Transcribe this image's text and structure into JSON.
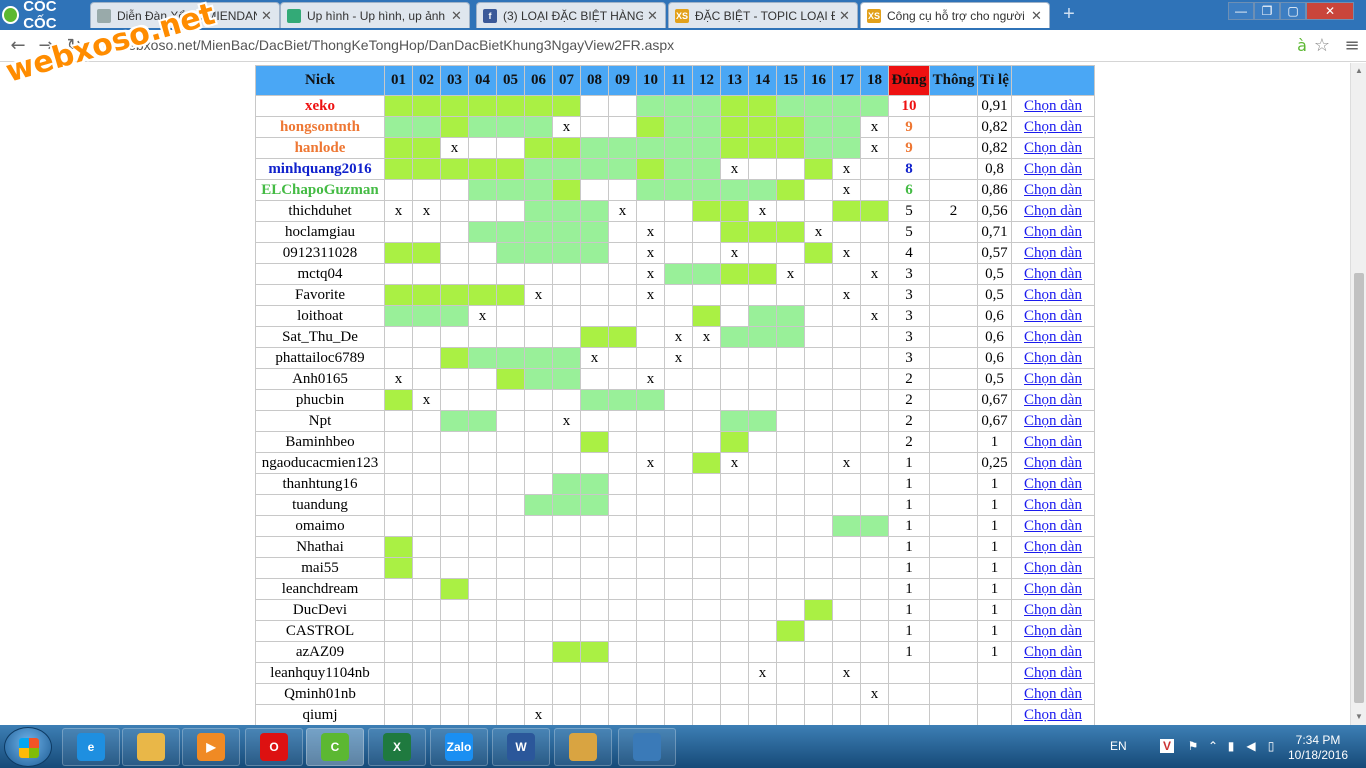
{
  "browser": {
    "logo_text": "CỐC CỐC",
    "tabs": [
      {
        "title": "Diễn Đàn Xổ Số MIENDAN",
        "icon": "doc-icon",
        "active": false
      },
      {
        "title": "Up hình - Up hình, up ảnh",
        "icon": "image-icon",
        "active": false
      },
      {
        "title": "(3) LOẠI ĐẶC BIỆT HÀNG N",
        "icon": "facebook-icon",
        "active": false
      },
      {
        "title": "ĐẶC BIỆT - TOPIC LOẠI ĐẶ",
        "icon": "xs-icon",
        "active": false
      },
      {
        "title": "Công cụ hỗ trợ cho người",
        "icon": "xs-icon",
        "active": true
      }
    ],
    "url_prefix": "",
    "url": "webxoso.net/MienBac/DacBiet/ThongKeTongHop/DanDacBietKhung3NgayView2FR.aspx",
    "watermark": "webxoso.net"
  },
  "table": {
    "headers": {
      "nick": "Nick",
      "days": [
        "01",
        "02",
        "03",
        "04",
        "05",
        "06",
        "07",
        "08",
        "09",
        "10",
        "11",
        "12",
        "13",
        "14",
        "15",
        "16",
        "17",
        "18"
      ],
      "dung": "Đúng",
      "thong": "Thông",
      "tile": "Tỉ lệ",
      "action": ""
    },
    "link_label": "Chọn dàn",
    "rows": [
      {
        "nick": "xeko",
        "style": "red",
        "cells": [
          "a",
          "a",
          "a",
          "a",
          "a",
          "a",
          "a",
          "",
          "",
          "b",
          "b",
          "b",
          "a",
          "a",
          "b",
          "b",
          "b",
          "b"
        ],
        "dung": "10",
        "thong": "",
        "tile": "0,91"
      },
      {
        "nick": "hongsontnth",
        "style": "orange",
        "cells": [
          "b",
          "b",
          "a",
          "b",
          "b",
          "b",
          "x",
          "",
          "",
          "a",
          "b",
          "b",
          "a",
          "a",
          "a",
          "b",
          "b",
          "x"
        ],
        "dung": "9",
        "thong": "",
        "tile": "0,82"
      },
      {
        "nick": "hanlode",
        "style": "orange",
        "cells": [
          "a",
          "a",
          "x",
          "",
          "",
          "a",
          "a",
          "b",
          "b",
          "b",
          "b",
          "b",
          "a",
          "a",
          "a",
          "b",
          "b",
          "x"
        ],
        "dung": "9",
        "thong": "",
        "tile": "0,82"
      },
      {
        "nick": "minhquang2016",
        "style": "blue",
        "cells": [
          "a",
          "a",
          "a",
          "a",
          "a",
          "b",
          "b",
          "b",
          "b",
          "a",
          "b",
          "b",
          "x",
          "",
          "",
          "a",
          "x",
          ""
        ],
        "dung": "8",
        "thong": "",
        "tile": "0,8"
      },
      {
        "nick": "ELChapoGuzman",
        "style": "green",
        "cells": [
          "",
          "",
          "",
          "b",
          "b",
          "b",
          "a",
          "",
          "",
          "b",
          "b",
          "b",
          "b",
          "b",
          "a",
          "",
          "x",
          ""
        ],
        "dung": "6",
        "thong": "",
        "tile": "0,86"
      },
      {
        "nick": "thichduhet",
        "style": "",
        "cells": [
          "x",
          "x",
          "",
          "",
          "",
          "b",
          "b",
          "b",
          "x",
          "",
          "",
          "a",
          "a",
          "x",
          "",
          "",
          "a",
          "a"
        ],
        "dung": "5",
        "thong": "2",
        "tile": "0,56"
      },
      {
        "nick": "hoclamgiau",
        "style": "",
        "cells": [
          "",
          "",
          "",
          "b",
          "b",
          "b",
          "b",
          "b",
          "",
          "x",
          "",
          "",
          "a",
          "a",
          "a",
          "x",
          "",
          ""
        ],
        "dung": "5",
        "thong": "",
        "tile": "0,71"
      },
      {
        "nick": "0912311028",
        "style": "",
        "cells": [
          "a",
          "a",
          "",
          "",
          "b",
          "b",
          "b",
          "b",
          "",
          "x",
          "",
          "",
          "x",
          "",
          "",
          "a",
          "x",
          ""
        ],
        "dung": "4",
        "thong": "",
        "tile": "0,57"
      },
      {
        "nick": "mctq04",
        "style": "",
        "cells": [
          "",
          "",
          "",
          "",
          "",
          "",
          "",
          "",
          "",
          "x",
          "b",
          "b",
          "a",
          "a",
          "x",
          "",
          "",
          "x"
        ],
        "dung": "3",
        "thong": "",
        "tile": "0,5"
      },
      {
        "nick": "Favorite",
        "style": "",
        "cells": [
          "a",
          "a",
          "a",
          "a",
          "a",
          "x",
          "",
          "",
          "",
          "x",
          "",
          "",
          "",
          "",
          "",
          "",
          "x",
          ""
        ],
        "dung": "3",
        "thong": "",
        "tile": "0,5"
      },
      {
        "nick": "loithoat",
        "style": "",
        "cells": [
          "b",
          "b",
          "b",
          "x",
          "",
          "",
          "",
          "",
          "",
          "",
          "",
          "a",
          "",
          "b",
          "b",
          "",
          "",
          "x"
        ],
        "dung": "3",
        "thong": "",
        "tile": "0,6"
      },
      {
        "nick": "Sat_Thu_De",
        "style": "",
        "cells": [
          "",
          "",
          "",
          "",
          "",
          "",
          "",
          "a",
          "a",
          "",
          "x",
          "x",
          "b",
          "b",
          "b",
          "",
          "",
          ""
        ],
        "dung": "3",
        "thong": "",
        "tile": "0,6"
      },
      {
        "nick": "phattailoc6789",
        "style": "",
        "cells": [
          "",
          "",
          "a",
          "b",
          "b",
          "b",
          "b",
          "x",
          "",
          "",
          "x",
          "",
          "",
          "",
          "",
          "",
          "",
          ""
        ],
        "dung": "3",
        "thong": "",
        "tile": "0,6"
      },
      {
        "nick": "Anh0165",
        "style": "",
        "cells": [
          "x",
          "",
          "",
          "",
          "a",
          "b",
          "b",
          "",
          "",
          "x",
          "",
          "",
          "",
          "",
          "",
          "",
          "",
          ""
        ],
        "dung": "2",
        "thong": "",
        "tile": "0,5"
      },
      {
        "nick": "phucbin",
        "style": "",
        "cells": [
          "a",
          "x",
          "",
          "",
          "",
          "",
          "",
          "b",
          "b",
          "b",
          "",
          "",
          "",
          "",
          "",
          "",
          "",
          ""
        ],
        "dung": "2",
        "thong": "",
        "tile": "0,67"
      },
      {
        "nick": "Npt",
        "style": "",
        "cells": [
          "",
          "",
          "b",
          "b",
          "",
          "",
          "x",
          "",
          "",
          "",
          "",
          "",
          "b",
          "b",
          "",
          "",
          "",
          ""
        ],
        "dung": "2",
        "thong": "",
        "tile": "0,67"
      },
      {
        "nick": "Baminhbeo",
        "style": "",
        "cells": [
          "",
          "",
          "",
          "",
          "",
          "",
          "",
          "a",
          "",
          "",
          "",
          "",
          "a",
          "",
          "",
          "",
          "",
          ""
        ],
        "dung": "2",
        "thong": "",
        "tile": "1"
      },
      {
        "nick": "ngaoducacmien123",
        "style": "",
        "cells": [
          "",
          "",
          "",
          "",
          "",
          "",
          "",
          "",
          "",
          "x",
          "",
          "a",
          "x",
          "",
          "",
          "",
          "x",
          ""
        ],
        "dung": "1",
        "thong": "",
        "tile": "0,25"
      },
      {
        "nick": "thanhtung16",
        "style": "",
        "cells": [
          "",
          "",
          "",
          "",
          "",
          "",
          "b",
          "b",
          "",
          "",
          "",
          "",
          "",
          "",
          "",
          "",
          "",
          ""
        ],
        "dung": "1",
        "thong": "",
        "tile": "1"
      },
      {
        "nick": "tuandung",
        "style": "",
        "cells": [
          "",
          "",
          "",
          "",
          "",
          "b",
          "b",
          "b",
          "",
          "",
          "",
          "",
          "",
          "",
          "",
          "",
          "",
          ""
        ],
        "dung": "1",
        "thong": "",
        "tile": "1"
      },
      {
        "nick": "omaimo",
        "style": "",
        "cells": [
          "",
          "",
          "",
          "",
          "",
          "",
          "",
          "",
          "",
          "",
          "",
          "",
          "",
          "",
          "",
          "",
          "b",
          "b"
        ],
        "dung": "1",
        "thong": "",
        "tile": "1"
      },
      {
        "nick": "Nhathai",
        "style": "",
        "cells": [
          "a",
          "",
          "",
          "",
          "",
          "",
          "",
          "",
          "",
          "",
          "",
          "",
          "",
          "",
          "",
          "",
          "",
          ""
        ],
        "dung": "1",
        "thong": "",
        "tile": "1"
      },
      {
        "nick": "mai55",
        "style": "",
        "cells": [
          "a",
          "",
          "",
          "",
          "",
          "",
          "",
          "",
          "",
          "",
          "",
          "",
          "",
          "",
          "",
          "",
          "",
          ""
        ],
        "dung": "1",
        "thong": "",
        "tile": "1"
      },
      {
        "nick": "leanchdream",
        "style": "",
        "cells": [
          "",
          "",
          "a",
          "",
          "",
          "",
          "",
          "",
          "",
          "",
          "",
          "",
          "",
          "",
          "",
          "",
          "",
          ""
        ],
        "dung": "1",
        "thong": "",
        "tile": "1"
      },
      {
        "nick": "DucDevi",
        "style": "",
        "cells": [
          "",
          "",
          "",
          "",
          "",
          "",
          "",
          "",
          "",
          "",
          "",
          "",
          "",
          "",
          "",
          "a",
          "",
          ""
        ],
        "dung": "1",
        "thong": "",
        "tile": "1"
      },
      {
        "nick": "CASTROL",
        "style": "",
        "cells": [
          "",
          "",
          "",
          "",
          "",
          "",
          "",
          "",
          "",
          "",
          "",
          "",
          "",
          "",
          "a",
          "",
          "",
          ""
        ],
        "dung": "1",
        "thong": "",
        "tile": "1"
      },
      {
        "nick": "azAZ09",
        "style": "",
        "cells": [
          "",
          "",
          "",
          "",
          "",
          "",
          "a",
          "a",
          "",
          "",
          "",
          "",
          "",
          "",
          "",
          "",
          "",
          ""
        ],
        "dung": "1",
        "thong": "",
        "tile": "1"
      },
      {
        "nick": "leanhquy1104nb",
        "style": "",
        "cells": [
          "",
          "",
          "",
          "",
          "",
          "",
          "",
          "",
          "",
          "",
          "",
          "",
          "",
          "x",
          "",
          "",
          "x",
          ""
        ],
        "dung": "",
        "thong": "",
        "tile": ""
      },
      {
        "nick": "Qminh01nb",
        "style": "",
        "cells": [
          "",
          "",
          "",
          "",
          "",
          "",
          "",
          "",
          "",
          "",
          "",
          "",
          "",
          "",
          "",
          "",
          "",
          "x"
        ],
        "dung": "",
        "thong": "",
        "tile": ""
      },
      {
        "nick": "qiumj",
        "style": "",
        "cells": [
          "",
          "",
          "",
          "",
          "",
          "x",
          "",
          "",
          "",
          "",
          "",
          "",
          "",
          "",
          "",
          "",
          "",
          ""
        ],
        "dung": "",
        "thong": "",
        "tile": ""
      }
    ],
    "mark_x": "x",
    "colors": {
      "cell_a": "#aaf044",
      "cell_b": "#99f099",
      "header": "#4aa7f5",
      "dung_header": "#ee1111"
    }
  },
  "taskbar": {
    "apps": [
      {
        "name": "ie-icon",
        "label": "e"
      },
      {
        "name": "explorer-icon",
        "label": ""
      },
      {
        "name": "media-player-icon",
        "label": "▶"
      },
      {
        "name": "opera-icon",
        "label": "O"
      },
      {
        "name": "coccoc-icon",
        "label": "C"
      },
      {
        "name": "excel-icon",
        "label": "X"
      },
      {
        "name": "zalo-icon",
        "label": "Zalo"
      },
      {
        "name": "word-icon",
        "label": "W"
      },
      {
        "name": "paint-icon",
        "label": ""
      },
      {
        "name": "photo-viewer-icon",
        "label": ""
      }
    ],
    "language": "EN",
    "time": "7:34 PM",
    "date": "10/18/2016"
  }
}
